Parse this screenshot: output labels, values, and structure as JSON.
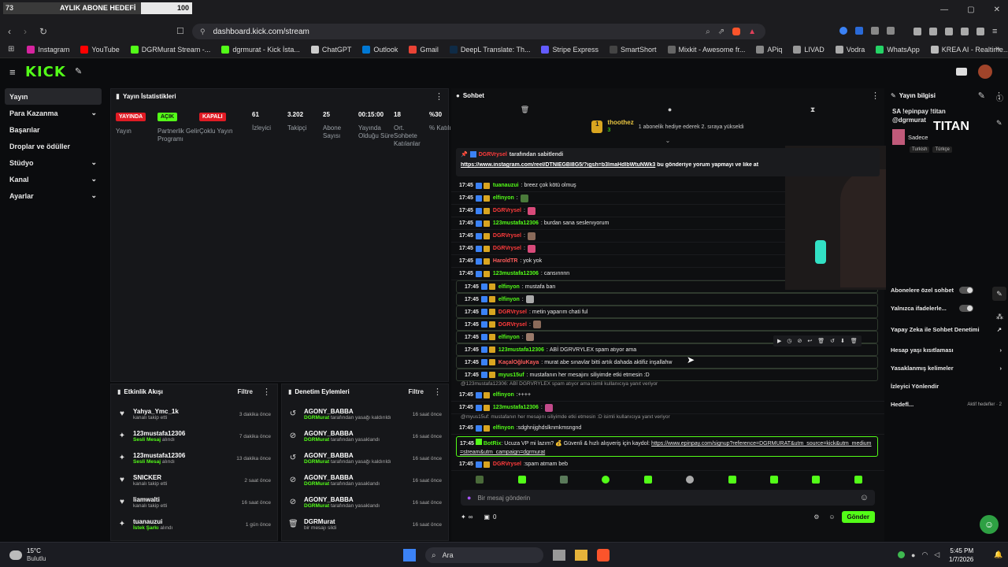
{
  "progress": {
    "current": "73",
    "label": "AYLIK ABONE HEDEFİ",
    "goal": "100",
    "fraction": 0.73
  },
  "window_controls": {
    "minimize": "—",
    "maximize": "▢",
    "close": "✕"
  },
  "browser": {
    "url": "dashboard.kick.com/stream"
  },
  "bookmarks": [
    {
      "label": "Instagram",
      "color": "#d6249f"
    },
    {
      "label": "YouTube",
      "color": "#ff0000"
    },
    {
      "label": "DGRMurat Stream -...",
      "color": "#53fc18"
    },
    {
      "label": "dgrmurat - Kick İsta...",
      "color": "#53fc18"
    },
    {
      "label": "ChatGPT",
      "color": "#cccccc"
    },
    {
      "label": "Outlook",
      "color": "#0078d4"
    },
    {
      "label": "Gmail",
      "color": "#ea4335"
    },
    {
      "label": "DeepL Translate: Th...",
      "color": "#0f2b46"
    },
    {
      "label": "Stripe Express",
      "color": "#635bff"
    },
    {
      "label": "SmartShort",
      "color": "#444444"
    },
    {
      "label": "Mixkit - Awesome fr...",
      "color": "#666666"
    },
    {
      "label": "APiq",
      "color": "#888888"
    },
    {
      "label": "LIVAD",
      "color": "#999999"
    },
    {
      "label": "Vodra",
      "color": "#aaaaaa"
    },
    {
      "label": "WhatsApp",
      "color": "#25d366"
    },
    {
      "label": "KREA AI - Realtime...",
      "color": "#bbbbbb"
    }
  ],
  "kick": {
    "logo": "KICK"
  },
  "sidebar": {
    "items": [
      {
        "label": "Yayın",
        "active": true,
        "chevron": false
      },
      {
        "label": "Para Kazanma",
        "chevron": true
      },
      {
        "label": "Başarılar",
        "chevron": false
      },
      {
        "label": "Droplar ve ödüller",
        "chevron": false
      },
      {
        "label": "Stüdyo",
        "chevron": true
      },
      {
        "label": "Kanal",
        "chevron": true
      },
      {
        "label": "Ayarlar",
        "chevron": true
      }
    ]
  },
  "stats": {
    "title": "Yayın İstatistikleri",
    "badges": [
      {
        "badge": "YAYINDA",
        "color": "#e01b24",
        "label": "Yayın"
      },
      {
        "badge": "AÇIK",
        "color": "#53fc18",
        "label": "Partnerlik Gelir Programı"
      },
      {
        "badge": "KAPALI",
        "color": "#e01b24",
        "label": "Çoklu Yayın"
      }
    ],
    "metrics": [
      {
        "value": "61",
        "label": "İzleyici"
      },
      {
        "value": "3.202",
        "label": "Takipçi"
      },
      {
        "value": "25",
        "label": "Abone Sayısı"
      },
      {
        "value": "00:15:00",
        "label": "Yayında Olduğu Süre"
      },
      {
        "value": "18",
        "label": "Ort. Sohbete Katılanlar"
      },
      {
        "value": "%30",
        "label": "% Katılım"
      }
    ]
  },
  "activity": {
    "title": "Etkinlik Akışı",
    "filter": "Filtre",
    "items": [
      {
        "name": "Yahya_Ymc_1k",
        "sub": "kanalı takip etti",
        "time": "3 dakika önce",
        "icon": "♥"
      },
      {
        "name": "123mustafa12306",
        "sub_hl": "Sesli Mesaj",
        "sub": "alındı",
        "time": "7 dakika önce",
        "icon": "✦"
      },
      {
        "name": "123mustafa12306",
        "sub_hl": "Sesli Mesaj",
        "sub": "alındı",
        "time": "13 dakika önce",
        "icon": "✦"
      },
      {
        "name": "SNICKER",
        "sub": "kanalı takip etti",
        "time": "2 saat önce",
        "icon": "♥"
      },
      {
        "name": "liamwalti",
        "sub": "kanalı takip etti",
        "time": "16 saat önce",
        "icon": "♥"
      },
      {
        "name": "tuanauzui",
        "sub_hl": "İstek Şarkı",
        "sub": "alındı",
        "time": "1 gün önce",
        "icon": "✦"
      }
    ]
  },
  "moderation": {
    "title": "Denetim Eylemleri",
    "filter": "Filtre",
    "items": [
      {
        "name": "AGONY_BABBA",
        "sub_hl": "DGRMurat",
        "sub": "tarafından yasağı kaldırıldı",
        "time": "16 saat önce",
        "icon": "↺"
      },
      {
        "name": "AGONY_BABBA",
        "sub_hl": "DGRMurat",
        "sub": "tarafından yasaklandı",
        "time": "16 saat önce",
        "icon": "⊘"
      },
      {
        "name": "AGONY_BABBA",
        "sub_hl": "DGRMurat",
        "sub": "tarafından yasağı kaldırıldı",
        "time": "16 saat önce",
        "icon": "↺"
      },
      {
        "name": "AGONY_BABBA",
        "sub_hl": "DGRMurat",
        "sub": "tarafından yasaklandı",
        "time": "16 saat önce",
        "icon": "⊘"
      },
      {
        "name": "AGONY_BABBA",
        "sub_hl": "DGRMurat",
        "sub": "tarafından yasaklandı",
        "time": "16 saat önce",
        "icon": "⊘"
      },
      {
        "name": "DGRMurat",
        "sub": "bir mesajı sildi",
        "time": "16 saat önce",
        "icon": "🗑"
      }
    ]
  },
  "chat": {
    "title": "Sohbet",
    "gift_user": "thoothez",
    "gift_count": "3",
    "gift_text": "1 abonelik hediye ederek 2. sıraya yükseldi",
    "pinned_by": "tarafından sabitlendi",
    "pinned_user": "DGRVrysel",
    "pinned_link": "https://www.instagram.com/reel/DTNIEGBI8G5/?igsh=b3lmaHdlbWtuNWk3",
    "pinned_text": "bu gönderiye yorum yapmayı ve like at",
    "messages": [
      {
        "time": "17:45",
        "user": "tuanauzui",
        "color": "#53fc18",
        "text": "breez çok kötü olmuş"
      },
      {
        "time": "17:45",
        "user": "elfinyon",
        "color": "#53fc18",
        "text": "",
        "emote": "#4a7a3a"
      },
      {
        "time": "17:45",
        "user": "DGRVrysel",
        "color": "#ff3b3b",
        "text": "",
        "emote": "#d84a7a"
      },
      {
        "time": "17:45",
        "user": "123mustafa12306",
        "color": "#53fc18",
        "text": "burdan sana seslenıyorum"
      },
      {
        "time": "17:45",
        "user": "DGRVrysel",
        "color": "#ff3b3b",
        "text": "",
        "emote": "#8a6a5a"
      },
      {
        "time": "17:45",
        "user": "DGRVrysel",
        "color": "#ff3b3b",
        "text": "",
        "emote": "#d84a7a"
      },
      {
        "time": "17:45",
        "user": "HaroldTR",
        "color": "#ff5c5c",
        "text": "yok yok"
      },
      {
        "time": "17:45",
        "user": "123mustafa12306",
        "color": "#53fc18",
        "text": "cansınnnn"
      },
      {
        "time": "17:45",
        "user": "elfinyon",
        "color": "#53fc18",
        "text": "mustafa ban"
      },
      {
        "time": "17:45",
        "user": "elfinyon",
        "color": "#53fc18",
        "text": "",
        "emote": "#aaaaaa"
      },
      {
        "time": "17:45",
        "user": "DGRVrysel",
        "color": "#ff3b3b",
        "text": "metin yaparım chati ful"
      },
      {
        "time": "17:45",
        "user": "DGRVrysel",
        "color": "#ff3b3b",
        "text": "",
        "emote": "#8a6a5a"
      },
      {
        "time": "17:45",
        "user": "elfinyon",
        "color": "#53fc18",
        "text": "",
        "emote": "#9a7a6a"
      },
      {
        "time": "17:45",
        "user": "123mustafa12306",
        "color": "#53fc18",
        "text": "ABİ DGRVRYLEX spam atıyor ama"
      },
      {
        "time": "17:45",
        "user": "KaçalOğluKaya",
        "color": "#ff5c5c",
        "text": "murat abe sınavlar bitti artık dahada aktifiz inşallahw"
      },
      {
        "time": "17:45",
        "user": "myus15uf",
        "color": "#53fc18",
        "text": "mustafanın her mesajını siliyimde etki etmesin :D"
      }
    ],
    "reply1_text": "@123mustafa12306: ABİ DGRVRYLEX spam atıyor ama isimli kullanıcıya yanıt veriyor",
    "reply1_msg": {
      "time": "17:45",
      "user": "elfinyon",
      "text": "++++"
    },
    "msg_mustafa_emote": {
      "time": "17:45",
      "user": "123mustafa12306"
    },
    "reply2_text": "@myus15uf: mustafanın her mesajını siliyimde etki etmesin :D isimli kullanıcıya yanıt veriyor",
    "reply2_msg": {
      "time": "17:45",
      "user": "elfinyon",
      "text": "sdghnijghdslknmkmsngnd"
    },
    "bot": {
      "time": "17:45",
      "user": "BotRix",
      "text": "Ucuza VP mi lazım? 💰 Güvenli & hızlı alışveriş için kaydol:",
      "link": "https://www.epinpay.com/signup?reference=DGRMURAT&utm_source=kick&utm_medium=stream&utm_campaign=dgrmurat"
    },
    "last": {
      "time": "17:45",
      "user": "DGRVrysel",
      "text": "spam atmam beb"
    },
    "input_placeholder": "Bir mesaj gönderin",
    "points": "∞",
    "count": "0",
    "send": "Gönder"
  },
  "right": {
    "title": "Yayın bilgisi",
    "stream_title": "SA !epinpay !titan @dgrmurat",
    "brand": "TITAN",
    "sub_label": "Sadece",
    "tags": [
      "Turkish",
      "Türkçe"
    ],
    "items": [
      {
        "label": "Abonelere özel sohbet",
        "type": "toggle"
      },
      {
        "label": "Yalnızca ifadelerle...",
        "type": "toggle"
      },
      {
        "label": "Yapay Zeka ile Sohbet Denetimi",
        "type": "link"
      },
      {
        "label": "Hesap yaşı kısıtlaması",
        "type": "chevron"
      },
      {
        "label": "Yasaklanmış kelimeler",
        "type": "chevron"
      },
      {
        "label": "İzleyici Yönlendir",
        "type": "none"
      },
      {
        "label": "Hedefl...",
        "type": "goal",
        "extra": "Aktif hedefler · 2"
      }
    ]
  },
  "taskbar": {
    "weather_temp": "15°C",
    "weather_desc": "Bulutlu",
    "search": "Ara",
    "time": "5:45 PM",
    "date": "1/7/2026"
  }
}
